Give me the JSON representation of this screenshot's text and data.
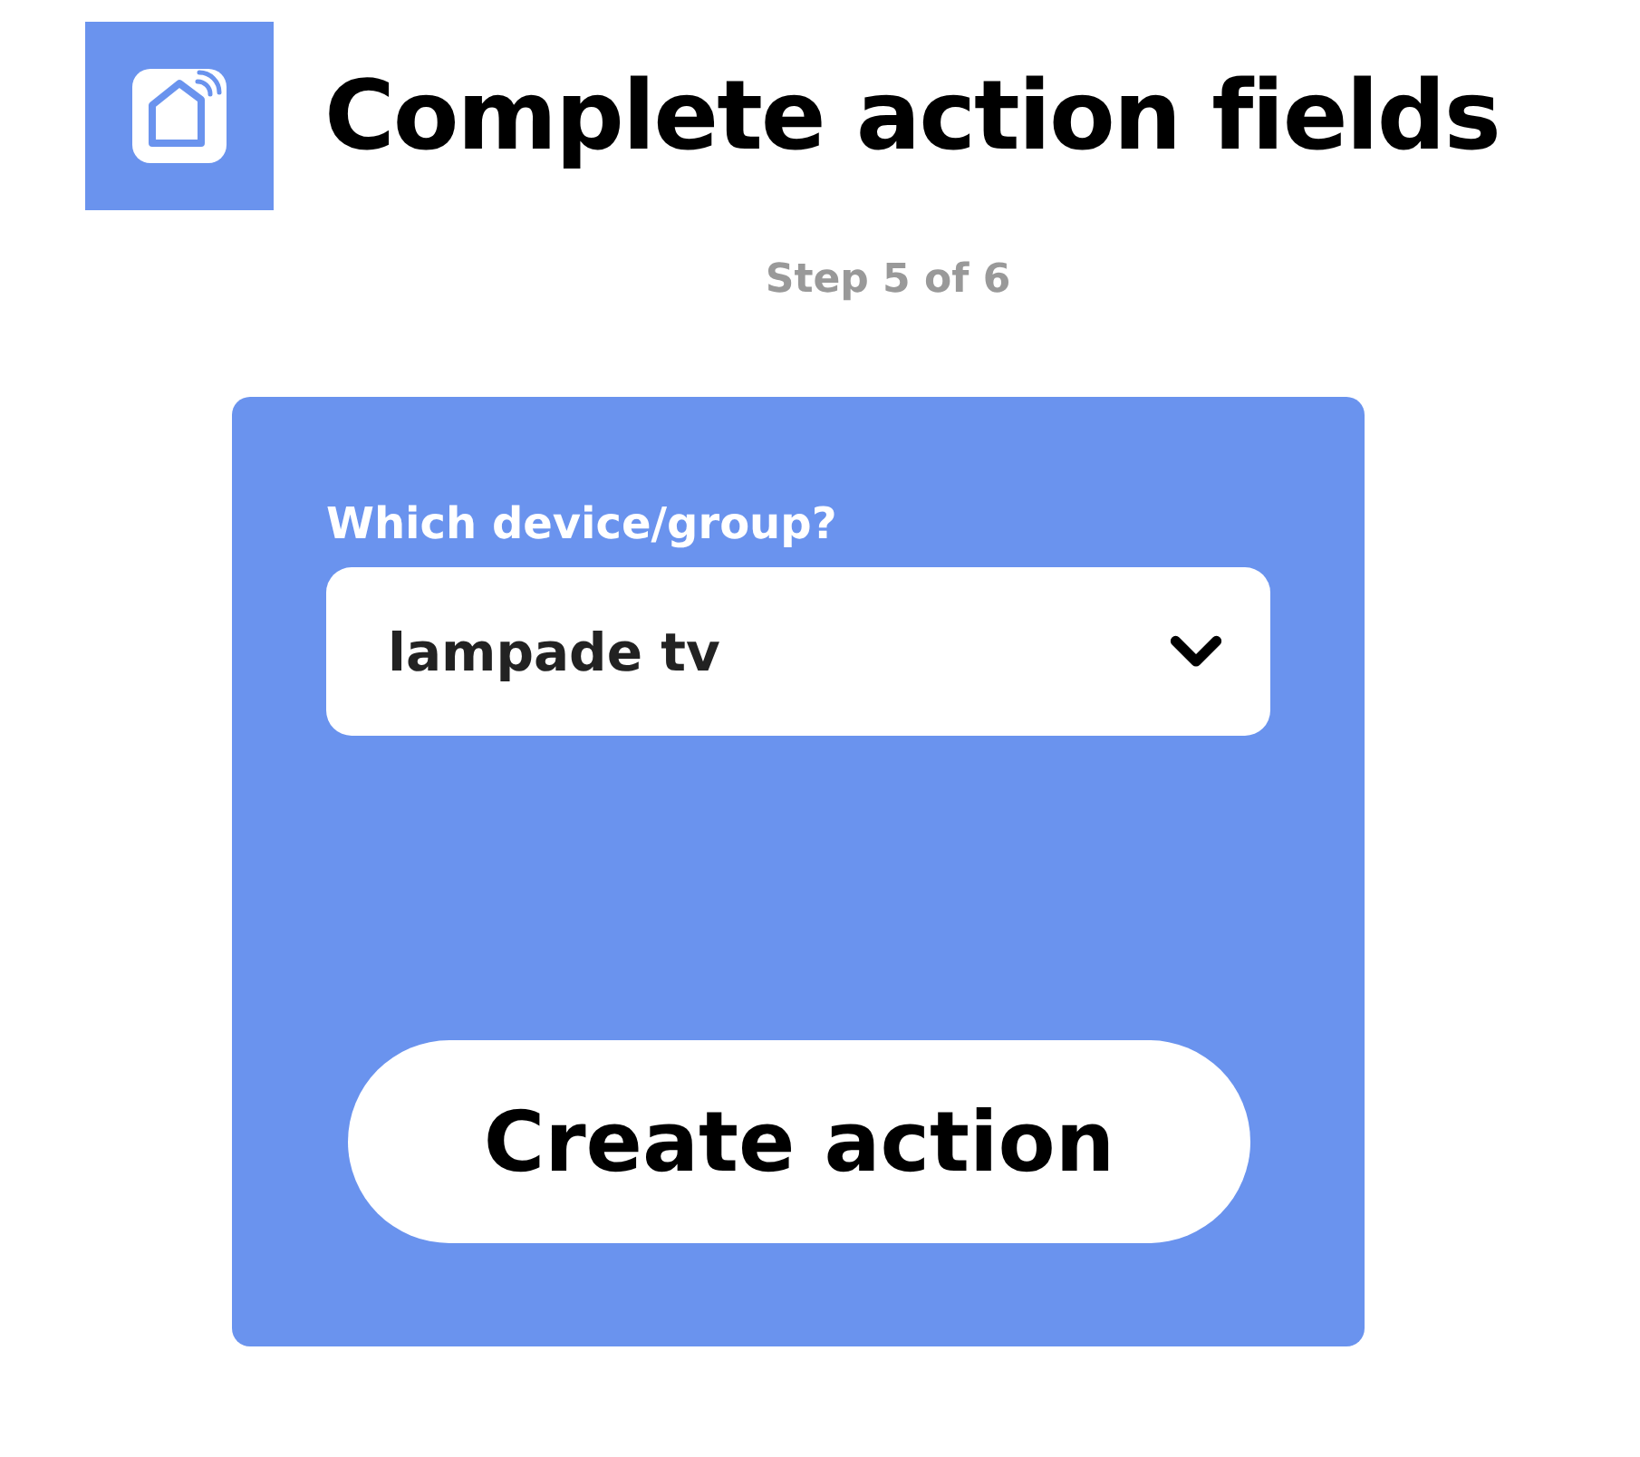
{
  "header": {
    "title": "Complete action fields",
    "step": "Step 5 of 6"
  },
  "form": {
    "field_label": "Which device/group?",
    "select_value": "lampade tv",
    "button": "Create action"
  }
}
